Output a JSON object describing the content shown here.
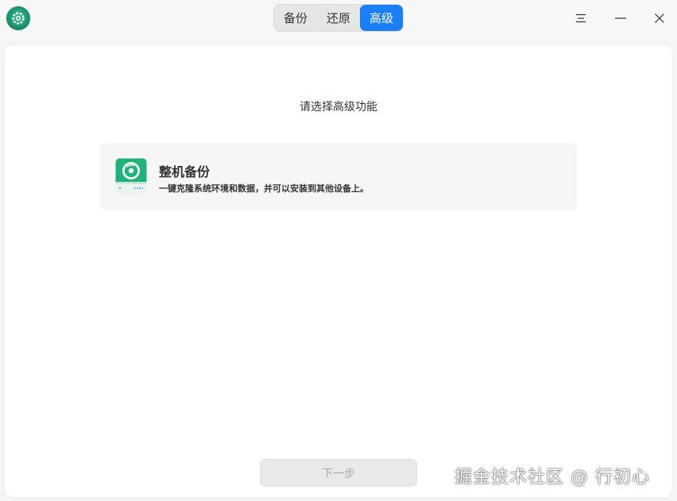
{
  "titlebar": {
    "tabs": [
      {
        "label": "备份",
        "active": false
      },
      {
        "label": "还原",
        "active": false
      },
      {
        "label": "高级",
        "active": true
      }
    ],
    "accent_color": "#1a7ff5",
    "icons": [
      "app-logo-icon",
      "hamburger-menu-icon",
      "minimize-icon",
      "close-icon"
    ]
  },
  "main": {
    "heading": "请选择高级功能",
    "option": {
      "title": "整机备份",
      "description": "一键克隆系统环境和数据，并可以安装到其他设备上。",
      "icon": "disk-backup-icon"
    },
    "next_button_label": "下一步",
    "next_button_state": "disabled"
  },
  "watermark": "掘金技术社区 @ 行初心"
}
